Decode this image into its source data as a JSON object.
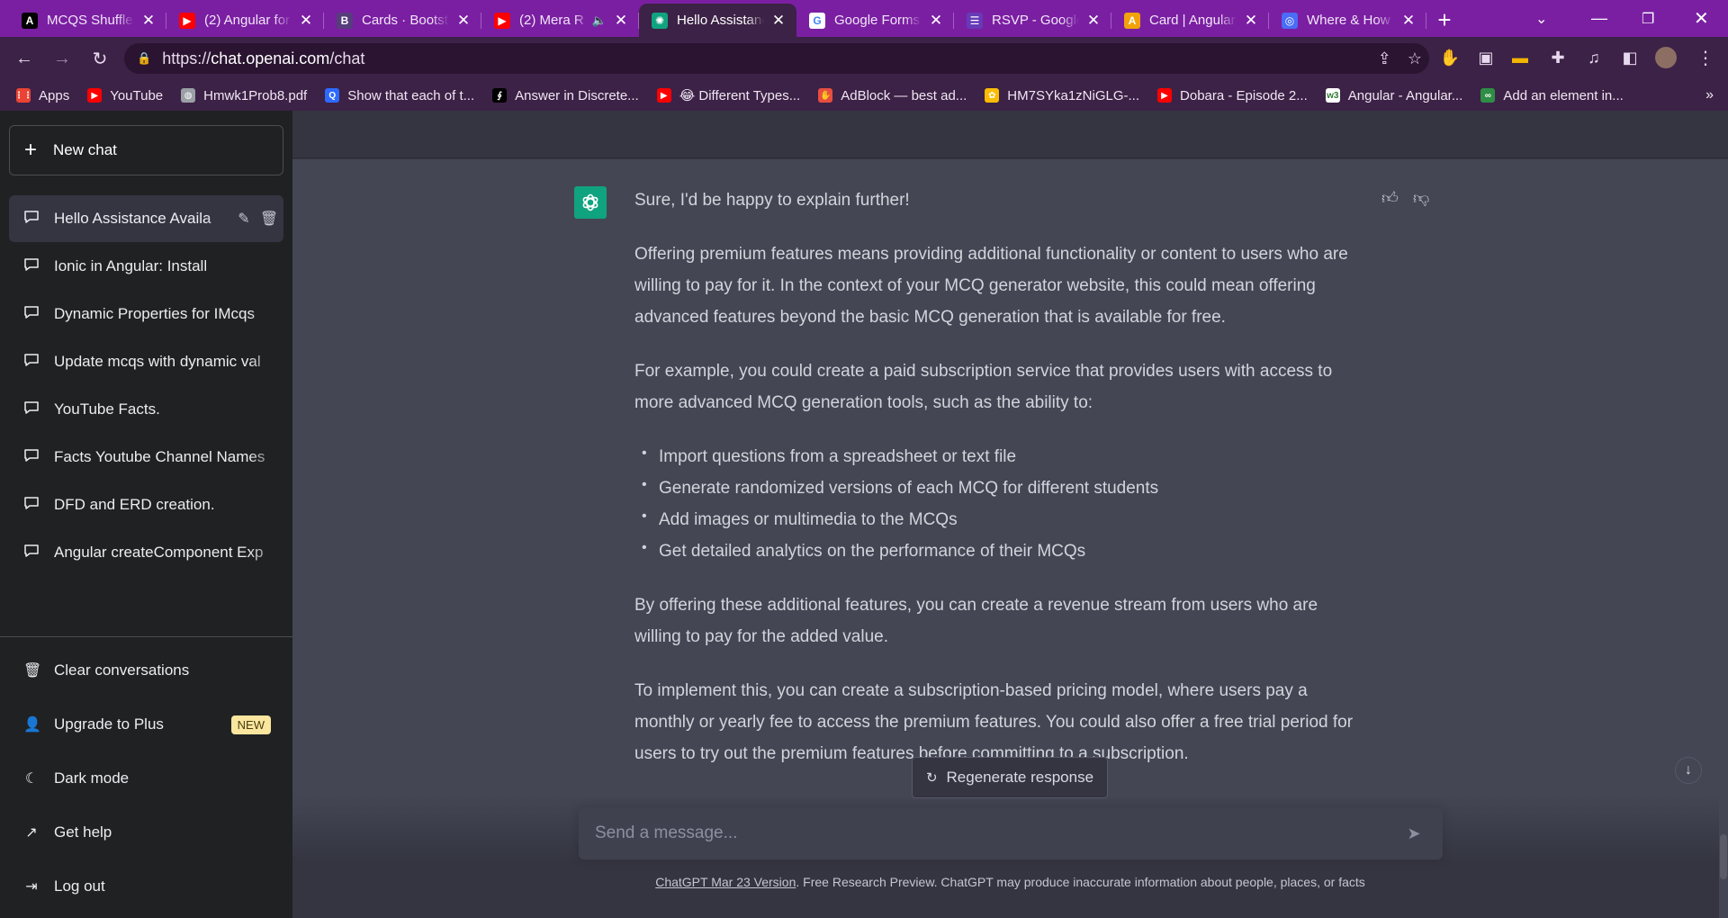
{
  "browser": {
    "tabs": [
      {
        "title": "MCQS Shuffler",
        "fav": "A",
        "fav_bg": "#000000",
        "active": false
      },
      {
        "title": "(2) Angular for",
        "fav": "▶",
        "fav_bg": "#ff0000",
        "active": false
      },
      {
        "title": "Cards · Bootstrap",
        "fav": "B",
        "fav_bg": "#563d7c",
        "active": false
      },
      {
        "title": "(2) Mera R",
        "fav": "▶",
        "fav_bg": "#ff0000",
        "active": false,
        "muted": true
      },
      {
        "title": "Hello Assistance",
        "fav": "✺",
        "fav_bg": "#10a37f",
        "active": true
      },
      {
        "title": "Google Forms",
        "fav": "G",
        "fav_bg": "#ffffff",
        "active": false
      },
      {
        "title": "RSVP - Google",
        "fav": "☰",
        "fav_bg": "#673ab7",
        "active": false
      },
      {
        "title": "Card | Angular",
        "fav": "A",
        "fav_bg": "#f2a20a",
        "active": false
      },
      {
        "title": "Where & How",
        "fav": "◎",
        "fav_bg": "#4a6cf7",
        "active": false
      }
    ],
    "url_scheme": "https://",
    "url_host": "chat.openai.com",
    "url_path": "/chat",
    "bookmarks": [
      {
        "label": "Apps",
        "icon": "apps-grid-icon",
        "color": "#ea4335"
      },
      {
        "label": "YouTube",
        "icon": "youtube-icon",
        "color": "#ff0000"
      },
      {
        "label": "Hmwk1Prob8.pdf",
        "icon": "globe-icon",
        "color": "#9aa0a6"
      },
      {
        "label": "Show that each of t...",
        "icon": "quora-icon",
        "color": "#2e69ff"
      },
      {
        "label": "Answer in Discrete...",
        "icon": "chegg-icon",
        "color": "#000000"
      },
      {
        "label": "😂 Different Types...",
        "icon": "youtube-icon",
        "color": "#ff0000"
      },
      {
        "label": "AdBlock — best ad...",
        "icon": "adblock-icon",
        "color": "#e84e40"
      },
      {
        "label": "HM7SYka1zNiGLG-...",
        "icon": "photos-icon",
        "color": "#fbbc04"
      },
      {
        "label": "Dobara - Episode 2...",
        "icon": "youtube-icon",
        "color": "#ff0000"
      },
      {
        "label": "Angular - Angular...",
        "icon": "w3schools-icon",
        "color": "#ffffff"
      },
      {
        "label": "Add an element in...",
        "icon": "geeks-icon",
        "color": "#2f8d46"
      }
    ]
  },
  "sidebar": {
    "new_chat": "New chat",
    "conversations": [
      {
        "label": "Hello Assistance Availa",
        "active": true
      },
      {
        "label": "Ionic in Angular: Install",
        "active": false
      },
      {
        "label": "Dynamic Properties for IMcqs",
        "active": false
      },
      {
        "label": "Update mcqs with dynamic val",
        "active": false
      },
      {
        "label": "YouTube Facts.",
        "active": false
      },
      {
        "label": "Facts Youtube Channel Names",
        "active": false
      },
      {
        "label": "DFD and ERD creation.",
        "active": false
      },
      {
        "label": "Angular createComponent Exp",
        "active": false
      }
    ],
    "menu": {
      "clear": "Clear conversations",
      "upgrade": "Upgrade to Plus",
      "new_badge": "NEW",
      "dark_mode": "Dark mode",
      "help": "Get help",
      "logout": "Log out"
    }
  },
  "chat": {
    "intro": "Sure, I'd be happy to explain further!",
    "p1": "Offering premium features means providing additional functionality or content to users who are willing to pay for it. In the context of your MCQ generator website, this could mean offering advanced features beyond the basic MCQ generation that is available for free.",
    "p2": "For example, you could create a paid subscription service that provides users with access to more advanced MCQ generation tools, such as the ability to:",
    "bullets": [
      "Import questions from a spreadsheet or text file",
      "Generate randomized versions of each MCQ for different students",
      "Add images or multimedia to the MCQs",
      "Get detailed analytics on the performance of their MCQs"
    ],
    "p3": "By offering these additional features, you can create a revenue stream from users who are willing to pay for the added value.",
    "p4": "To implement this, you can create a subscription-based pricing model, where users pay a monthly or yearly fee to access the premium features. You could also offer a free trial period for users to try out the premium features before committing to a subscription.",
    "regenerate": "Regenerate response",
    "input_placeholder": "Send a message...",
    "footer_link": "ChatGPT Mar 23 Version",
    "footer_text": ". Free Research Preview. ChatGPT may produce inaccurate information about people, places, or facts"
  },
  "colors": {
    "tabbar": "#7a1fa2",
    "sidebar": "#202123",
    "assistant_band": "#444654",
    "accent": "#10a37f"
  }
}
